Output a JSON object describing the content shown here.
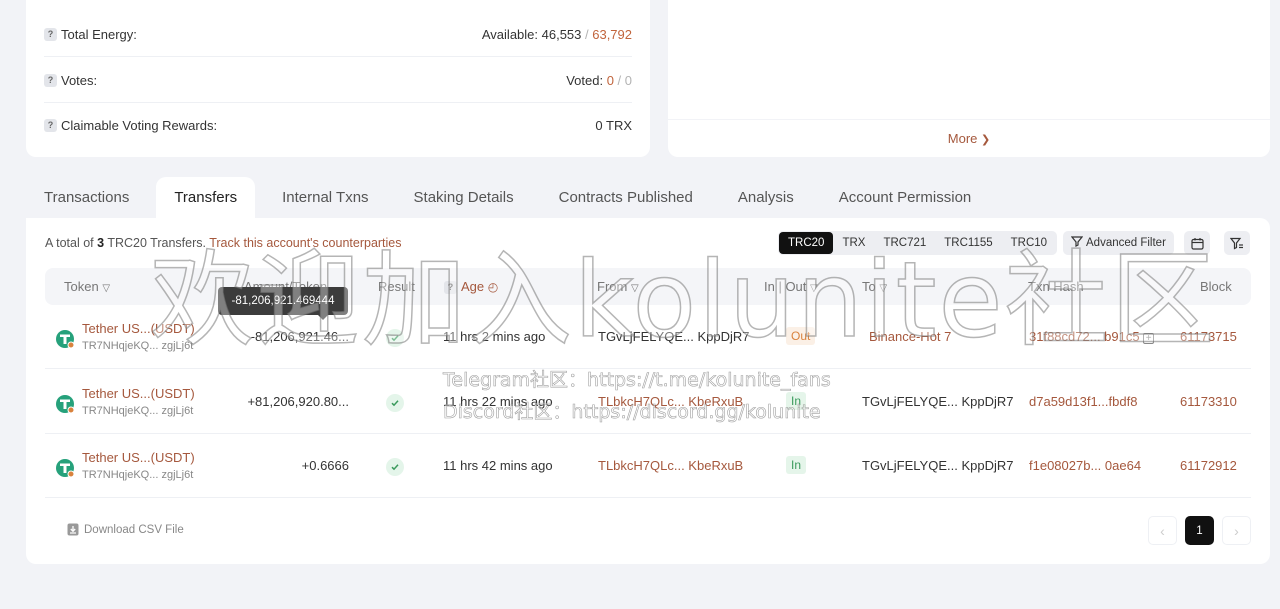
{
  "resources": {
    "total_energy": {
      "label": "Total Energy:",
      "prefix": "Available: ",
      "available": "46,553",
      "sep": " / ",
      "total": "63,792"
    },
    "votes": {
      "label": "Votes:",
      "prefix": "Voted: ",
      "voted": "0",
      "sep": " / ",
      "total": "0"
    },
    "rewards": {
      "label": "Claimable Voting Rewards:",
      "value": "0 TRX"
    }
  },
  "chart_panel": {
    "more_label": "More"
  },
  "tabs": [
    "Transactions",
    "Transfers",
    "Internal Txns",
    "Staking Details",
    "Contracts Published",
    "Analysis",
    "Account Permission"
  ],
  "active_tab": "Transfers",
  "summary": {
    "prefix": "A total of ",
    "count": "3",
    "suffix": " TRC20 Transfers. ",
    "track_label": "Track this account's counterparties"
  },
  "token_types": [
    "TRC20",
    "TRX",
    "TRC721",
    "TRC1155",
    "TRC10"
  ],
  "active_token_type": "TRC20",
  "advanced_filter_label": "Advanced Filter",
  "columns": {
    "token": "Token",
    "amount": "Amount/Token",
    "result": "Result",
    "age": "Age",
    "from": "From",
    "in_out": "In | Out",
    "to": "To",
    "txn_hash": "Txn Hash",
    "block": "Block"
  },
  "tooltip": "-81,206,921.469444",
  "rows": [
    {
      "token_name": "Tether US...(USDT)",
      "token_addr": "TR7NHqjeKQ... zgjLj6t",
      "amount": "-81,206,921.46...",
      "age": "11 hrs 2 mins ago",
      "from": "TGvLjFELYQE... KppDjR7",
      "from_link": false,
      "direction": "Out",
      "to": "Binance-Hot 7",
      "to_link": true,
      "hash": "31f88cd72... b91c5",
      "block": "61173715"
    },
    {
      "token_name": "Tether US...(USDT)",
      "token_addr": "TR7NHqjeKQ... zgjLj6t",
      "amount": "+81,206,920.80...",
      "age": "11 hrs 22 mins ago",
      "from": "TLbkcH7QLc... KbeRxuB",
      "from_link": true,
      "direction": "In",
      "to": "TGvLjFELYQE... KppDjR7",
      "to_link": false,
      "hash": "d7a59d13f1...fbdf8",
      "block": "61173310"
    },
    {
      "token_name": "Tether US...(USDT)",
      "token_addr": "TR7NHqjeKQ... zgjLj6t",
      "amount": "+0.6666",
      "age": "11 hrs 42 mins ago",
      "from": "TLbkcH7QLc... KbeRxuB",
      "from_link": true,
      "direction": "In",
      "to": "TGvLjFELYQE... KppDjR7",
      "to_link": false,
      "hash": "f1e08027b... 0ae64",
      "block": "61172912"
    }
  ],
  "csv_label": "Download CSV File",
  "pagination": {
    "current": "1"
  },
  "watermark": {
    "main": "欢迎加入kolunite社区",
    "telegram": "Telegram社区：https://t.me/kolunite_fans",
    "discord": "Discord社区：https://discord.gg/kolunite"
  },
  "colors": {
    "accent": "#a5583d",
    "out": "#d9823d",
    "in": "#3a9a5c",
    "tether": "#26a17b"
  }
}
